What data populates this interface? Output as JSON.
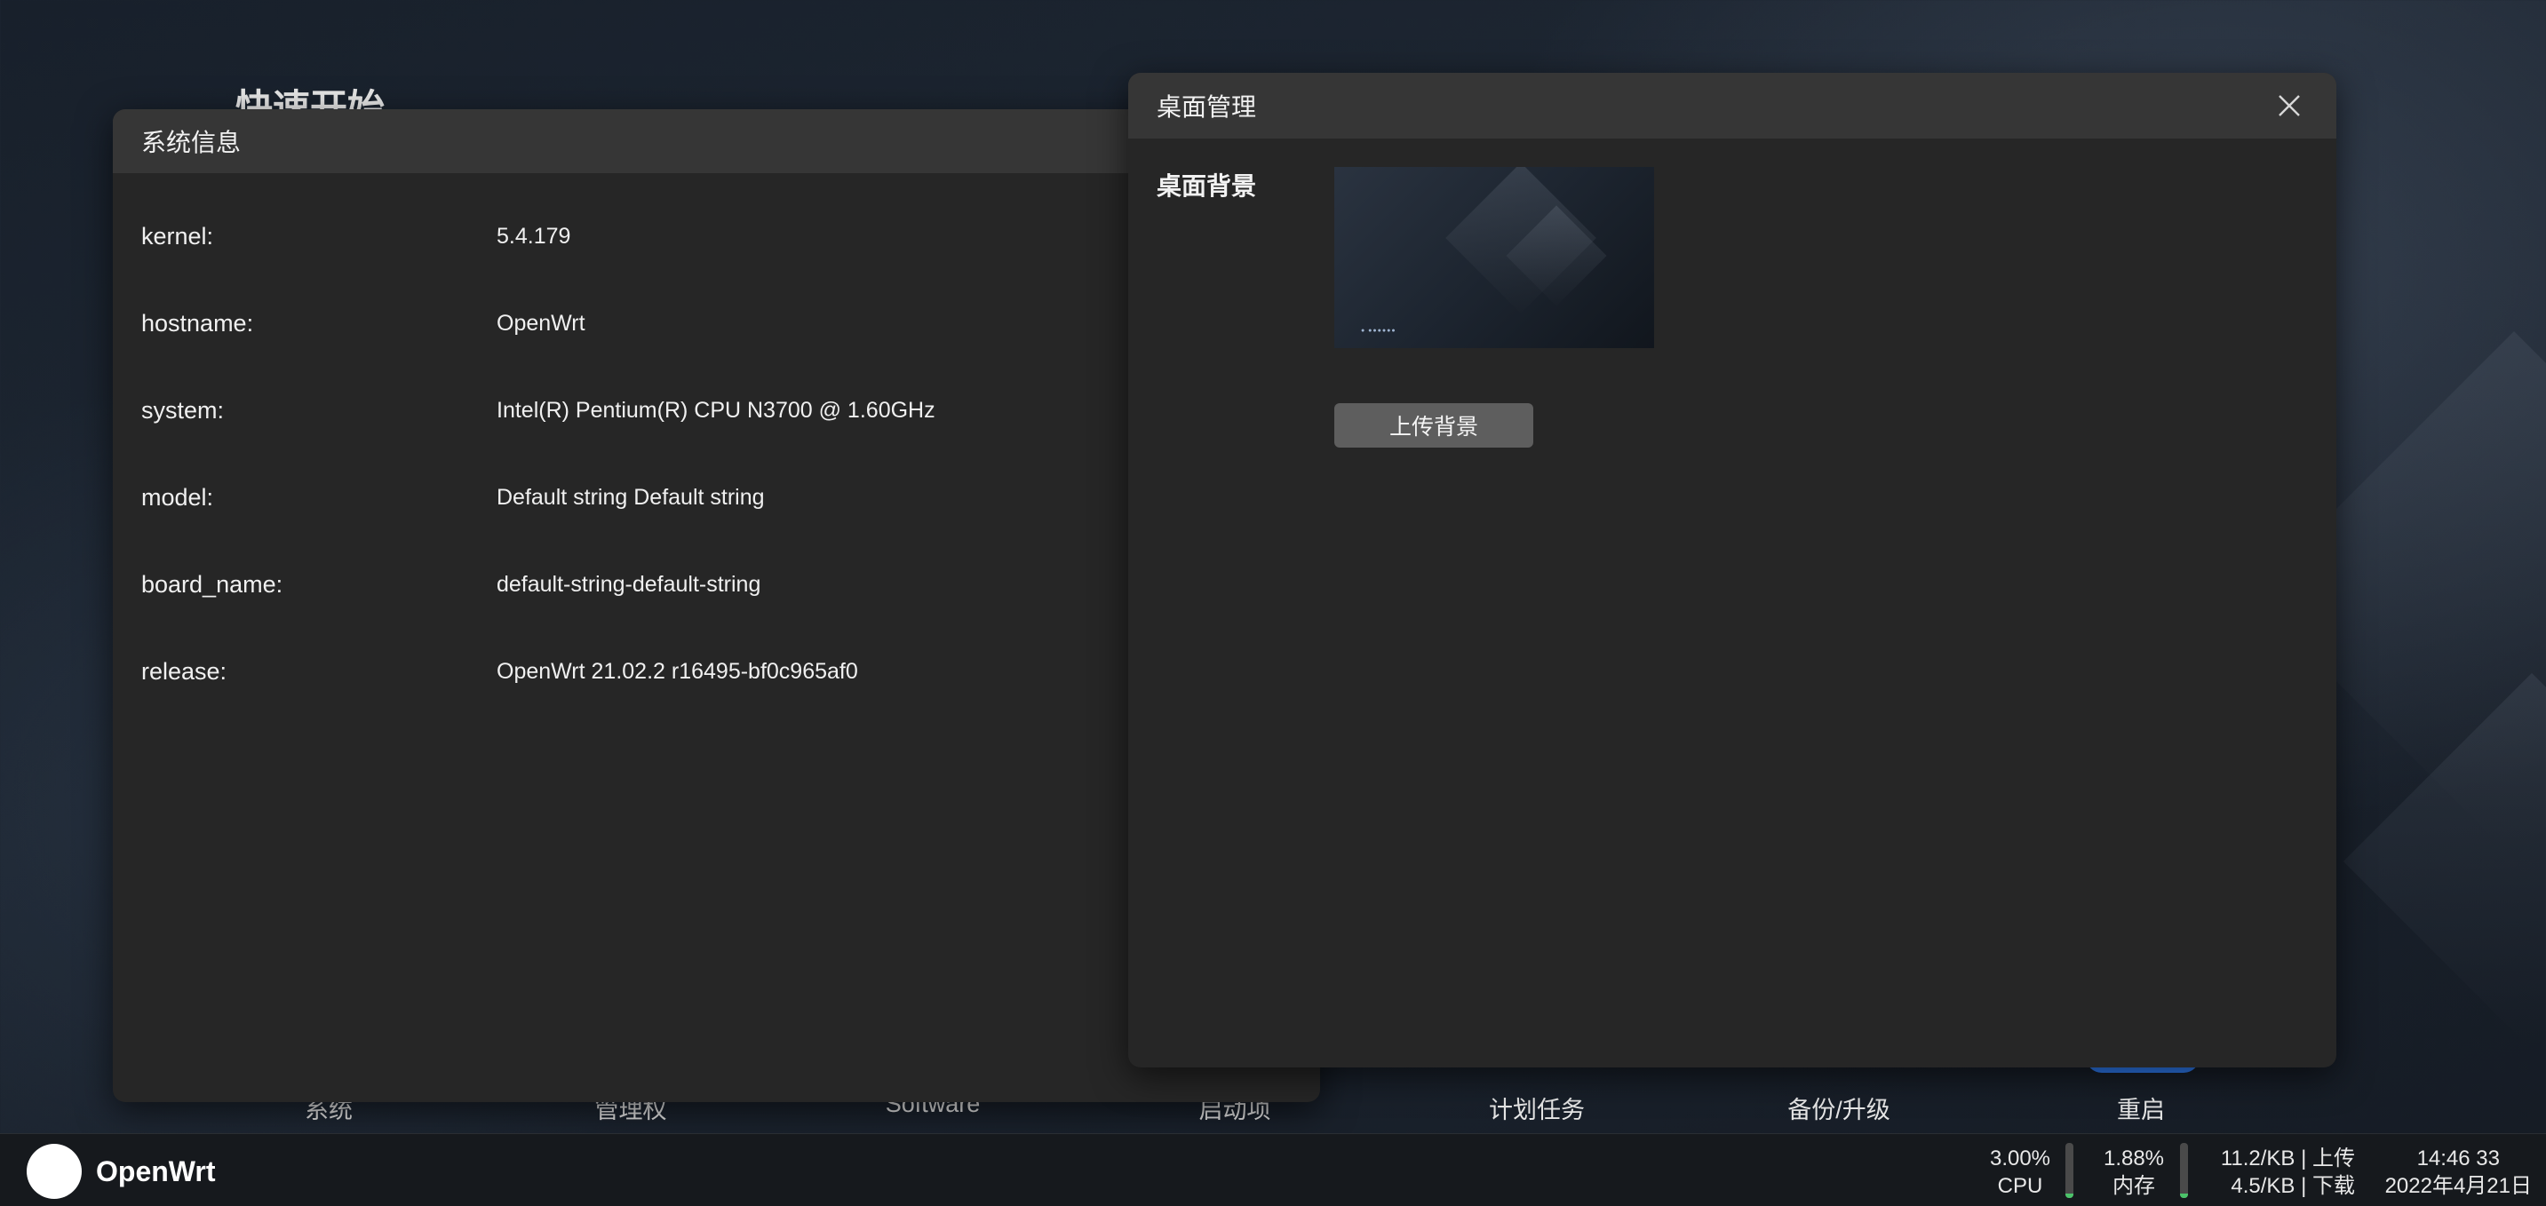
{
  "desktop": {
    "title": "快速开始",
    "icons": [
      {
        "label": "系统"
      },
      {
        "label": "管理权"
      },
      {
        "label": "Software"
      },
      {
        "label": "启动项"
      },
      {
        "label": "计划任务"
      },
      {
        "label": "备份/升级"
      },
      {
        "label": "重启"
      }
    ]
  },
  "sysinfo_window": {
    "title": "系统信息",
    "rows": [
      {
        "key": "kernel:",
        "value": "5.4.179"
      },
      {
        "key": "hostname:",
        "value": "OpenWrt"
      },
      {
        "key": "system:",
        "value": "Intel(R) Pentium(R) CPU N3700 @ 1.60GHz"
      },
      {
        "key": "model:",
        "value": "Default string Default string"
      },
      {
        "key": "board_name:",
        "value": "default-string-default-string"
      },
      {
        "key": "release:",
        "value": "OpenWrt 21.02.2 r16495-bf0c965af0"
      }
    ]
  },
  "desktop_manager_window": {
    "title": "桌面管理",
    "background_label": "桌面背景",
    "upload_button": "上传背景"
  },
  "taskbar": {
    "brand": "OpenWrt",
    "cpu": {
      "value": "3.00%",
      "label": "CPU",
      "fill_fraction": 0.03
    },
    "memory": {
      "value": "1.88%",
      "label": "内存",
      "fill_fraction": 0.0188
    },
    "network": {
      "upload": "11.2/KB | 上传",
      "download": "4.5/KB | 下载"
    },
    "clock": {
      "time": "14:46 33",
      "date": "2022年4月21日"
    }
  },
  "colors": {
    "accent_blue": "#2f7df6",
    "stat_bar_fill": "#4cc36a",
    "window_bg": "#262626",
    "titlebar_bg": "#363636"
  }
}
